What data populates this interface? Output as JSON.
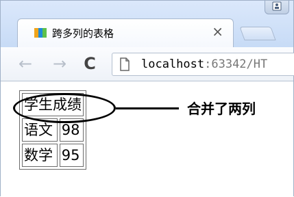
{
  "tab": {
    "title": "跨多列的表格",
    "close_label": "×"
  },
  "toolbar": {
    "back_label": "←",
    "forward_label": "→",
    "reload_label": "C",
    "url_host": "localhost",
    "url_rest": ":63342/HT"
  },
  "table": {
    "header": "学生成绩",
    "rows": [
      {
        "subject": "语文",
        "score": "98"
      },
      {
        "subject": "数学",
        "score": "95"
      }
    ]
  },
  "annotation": {
    "text": "合并了两列"
  },
  "colors": {
    "tab_strip": "#c7dbf6",
    "toolbar": "#eef2f8",
    "border": "#6b6b6b"
  },
  "icons": {
    "favicon": "colorful-favicon-icon",
    "page": "page-icon",
    "profile": "profile-icon"
  }
}
